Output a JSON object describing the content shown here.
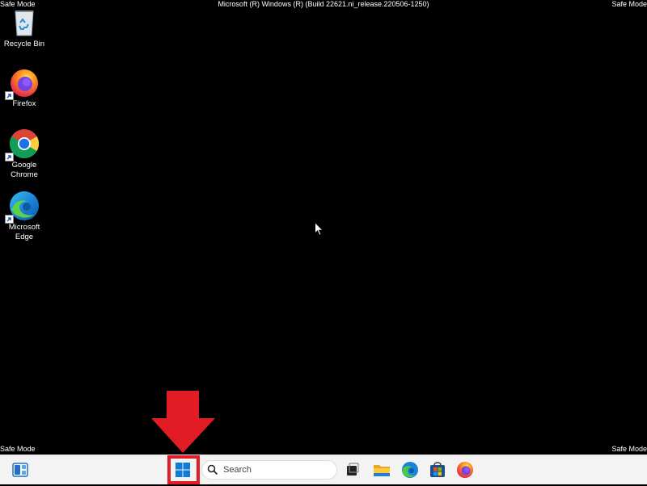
{
  "watermark": {
    "top_left": "Safe Mode",
    "top_right": "Safe Mode",
    "bottom_left": "Safe Mode",
    "bottom_right": "Safe Mode",
    "build_title": "Microsoft (R) Windows (R) (Build 22621.ni_release.220506-1250)"
  },
  "desktop": {
    "icons": [
      {
        "label": "Recycle Bin",
        "icon": "recycle-bin-icon"
      },
      {
        "label": "Firefox",
        "icon": "firefox-icon"
      },
      {
        "label": "Google Chrome",
        "icon": "chrome-icon"
      },
      {
        "label": "Microsoft Edge",
        "icon": "edge-icon"
      }
    ]
  },
  "taskbar": {
    "search_label": "Search",
    "items": [
      "widgets-icon",
      "start-icon",
      "search-icon",
      "task-view-icon",
      "file-explorer-icon",
      "edge-icon",
      "microsoft-store-icon",
      "firefox-icon"
    ]
  },
  "annotation": {
    "highlight_color": "#e21c24",
    "target": "start-button"
  },
  "colors": {
    "desktop_background": "#000000",
    "taskbar_background": "#f3f3f3",
    "windows_blue": "#0078d4"
  }
}
